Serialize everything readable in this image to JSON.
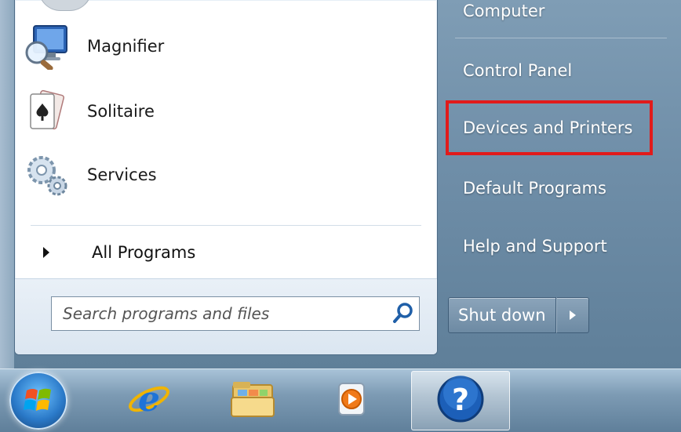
{
  "programs": [
    {
      "label": "Magnifier",
      "icon": "magnifier-icon"
    },
    {
      "label": "Solitaire",
      "icon": "solitaire-icon"
    },
    {
      "label": "Services",
      "icon": "services-gears-icon"
    }
  ],
  "all_programs": {
    "label": "All Programs"
  },
  "search": {
    "placeholder": "Search programs and files",
    "value": ""
  },
  "right_pane": {
    "items": [
      {
        "label": "Computer"
      },
      {
        "label": "Control Panel"
      },
      {
        "label": "Devices and Printers"
      },
      {
        "label": "Default Programs"
      },
      {
        "label": "Help and Support"
      }
    ],
    "highlighted_item": "Devices and Printers",
    "highlight_color": "#e11b1b"
  },
  "shutdown": {
    "label": "Shut down"
  },
  "taskbar": {
    "items": [
      {
        "icon": "start-orb-icon"
      },
      {
        "icon": "internet-explorer-icon"
      },
      {
        "icon": "file-explorer-folder-icon"
      },
      {
        "icon": "media-player-icon"
      },
      {
        "icon": "help-question-icon",
        "active": true
      }
    ]
  }
}
